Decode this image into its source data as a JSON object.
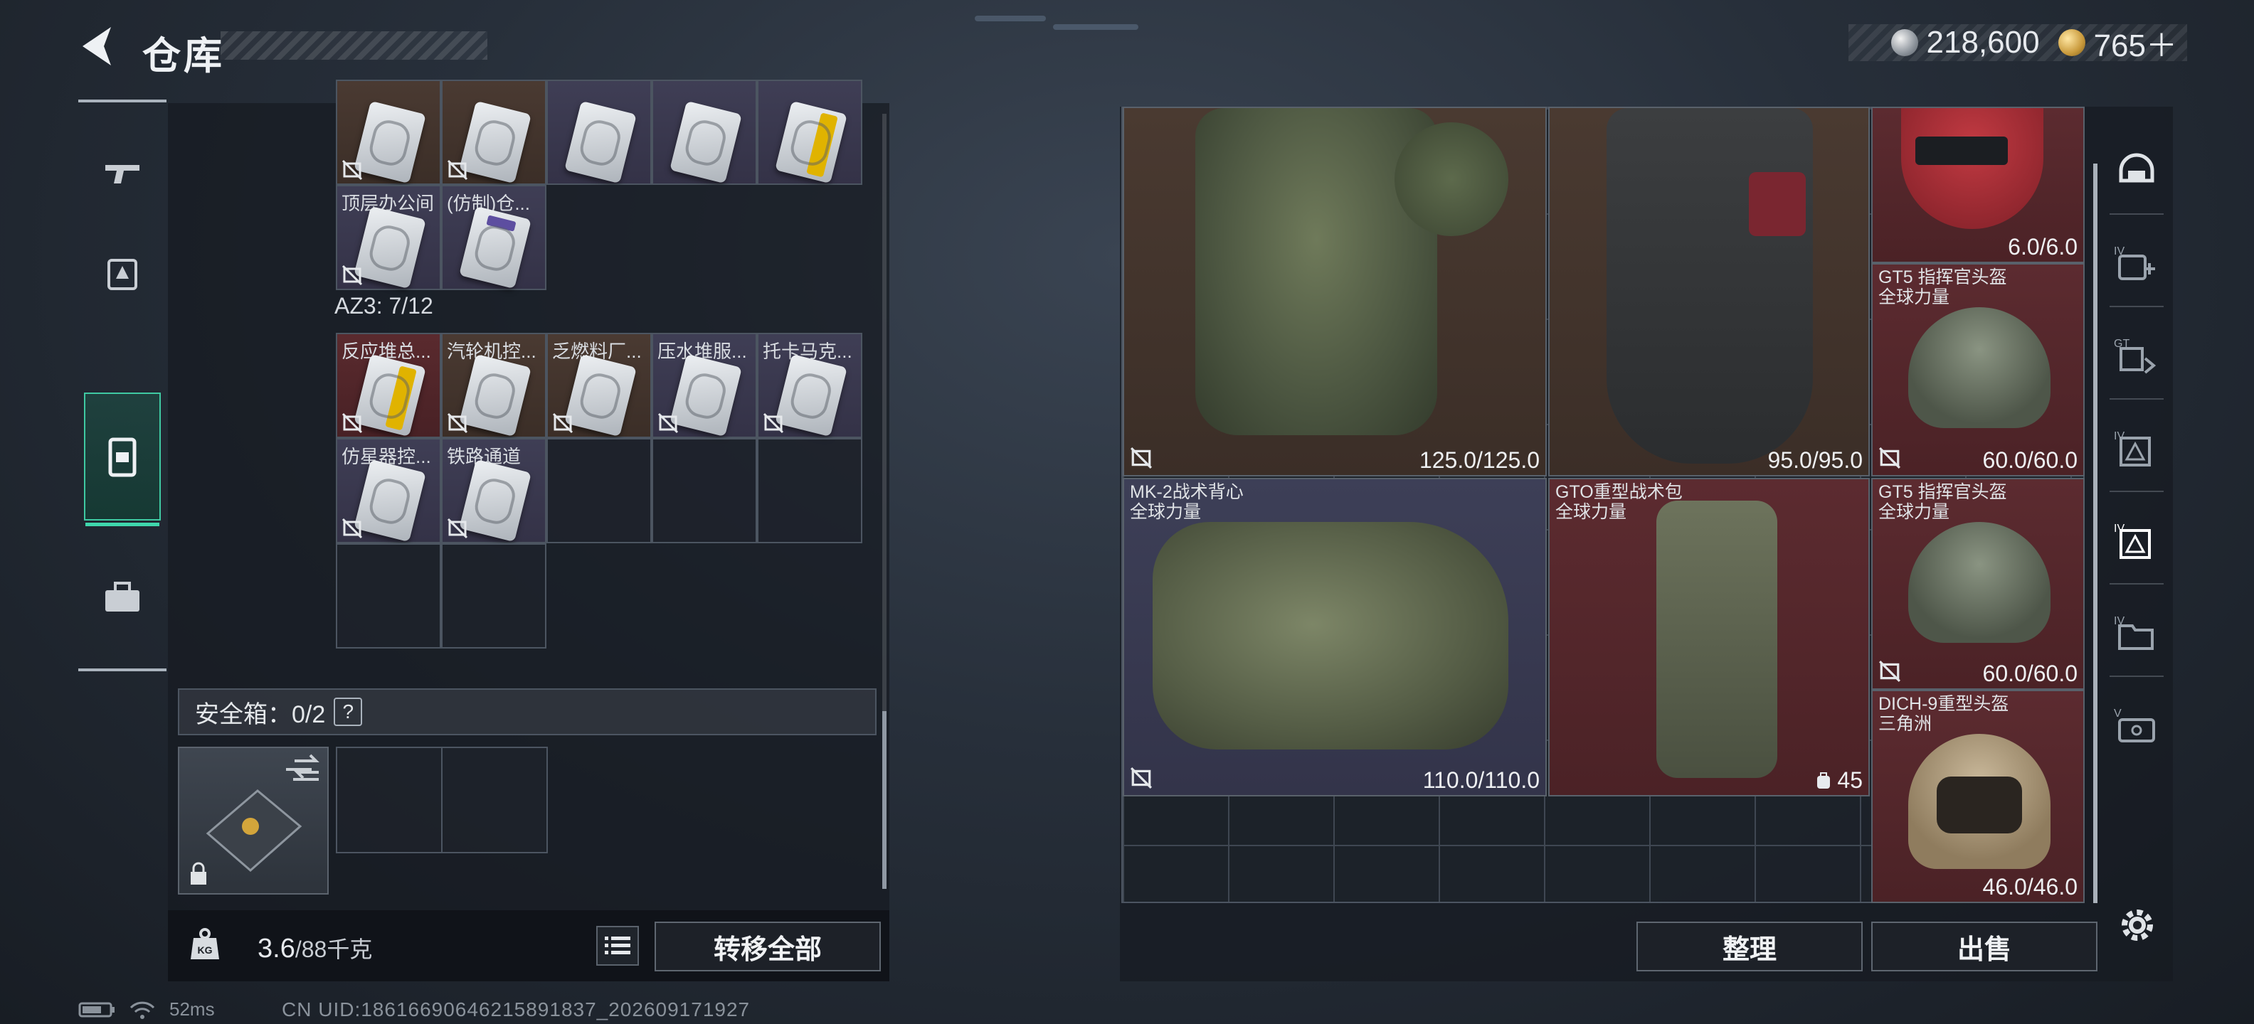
{
  "header": {
    "title": "仓库"
  },
  "currency": {
    "silver": "218,600",
    "gold": "765＋"
  },
  "left_rail": {
    "items": [
      "weapon-icon",
      "armor-loadout-icon",
      "backpack-icon",
      "toolbox-icon"
    ]
  },
  "storage": {
    "row0": [
      {
        "name": "",
        "color": "brown"
      },
      {
        "name": "",
        "color": "brown"
      },
      {
        "name": "",
        "color": "purple"
      },
      {
        "name": "",
        "color": "purple"
      },
      {
        "name": "",
        "color": "purple",
        "yellow": true
      }
    ],
    "row1": [
      {
        "name": "顶层办公间",
        "color": "purple"
      },
      {
        "name": "(仿制)仓...",
        "color": "purple",
        "purple_stripe": true
      }
    ],
    "group_label": "AZ3: 7/12",
    "az3_row0": [
      {
        "name": "反应堆总...",
        "color": "red",
        "yellow": true
      },
      {
        "name": "汽轮机控...",
        "color": "brown"
      },
      {
        "name": "乏燃料厂...",
        "color": "brown"
      },
      {
        "name": "压水堆服...",
        "color": "purple"
      },
      {
        "name": "托卡马克...",
        "color": "purple"
      }
    ],
    "az3_row1": [
      {
        "name": "仿星器控...",
        "color": "purple"
      },
      {
        "name": "铁路通道",
        "color": "purple"
      }
    ]
  },
  "safebox": {
    "label": "安全箱：0/2",
    "help": "?"
  },
  "footer": {
    "weight": "3.6",
    "weight_max": "/88千克",
    "transfer_all": "转移全部"
  },
  "items": {
    "vest1": {
      "durability": "125.0/125.0"
    },
    "vest2": {
      "durability": "95.0/95.0"
    },
    "helmet_top": {
      "durability": "6.0/6.0"
    },
    "helmet_gt5_a": {
      "name": "GT5 指挥官头盔",
      "faction": "全球力量",
      "durability": "60.0/60.0"
    },
    "vest_mk2": {
      "name": "MK-2战术背心",
      "faction": "全球力量",
      "durability": "110.0/110.0"
    },
    "backpack_gto": {
      "name": "GTO重型战术包",
      "faction": "全球力量",
      "capacity": "45"
    },
    "helmet_gt5_b": {
      "name": "GT5 指挥官头盔",
      "faction": "全球力量",
      "durability": "60.0/60.0"
    },
    "helmet_dich": {
      "name": "DICH-9重型头盔",
      "faction": "三角洲",
      "durability": "46.0/46.0"
    }
  },
  "actions": {
    "organize": "整理",
    "sell": "出售"
  },
  "right_rail": {
    "tier_labels": [
      "IV",
      "GT",
      "IV",
      "IV",
      "IV",
      "V"
    ]
  },
  "status": {
    "ping": "52ms",
    "uid": "CN UID:18616690646215891837_202609171927"
  }
}
